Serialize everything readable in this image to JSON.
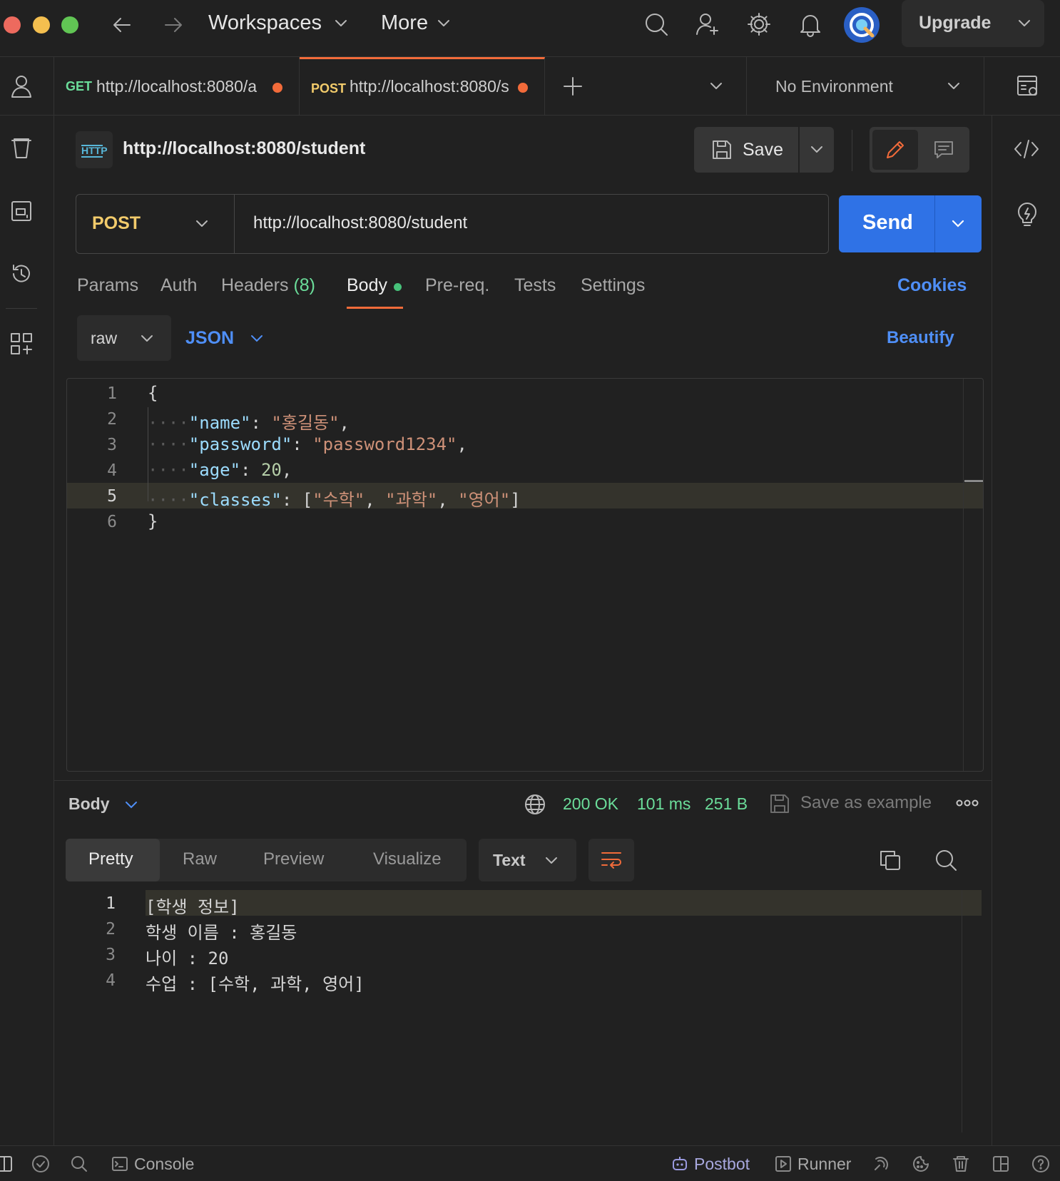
{
  "titlebar": {
    "workspaces_label": "Workspaces",
    "more_label": "More",
    "upgrade_label": "Upgrade"
  },
  "tabs": [
    {
      "method": "GET",
      "url": "http://localhost:8080/a",
      "unsaved": true
    },
    {
      "method": "POST",
      "url": "http://localhost:8080/s",
      "unsaved": true,
      "active": true
    }
  ],
  "environment": {
    "selected": "No Environment"
  },
  "request": {
    "title": "http://localhost:8080/student",
    "save_label": "Save",
    "method": "POST",
    "url": "http://localhost:8080/student",
    "send_label": "Send"
  },
  "request_tabs": {
    "params": "Params",
    "auth": "Auth",
    "headers": "Headers",
    "headers_count": "(8)",
    "body": "Body",
    "prereq": "Pre-req.",
    "tests": "Tests",
    "settings": "Settings",
    "cookies": "Cookies"
  },
  "body_options": {
    "mode": "raw",
    "language": "JSON",
    "beautify": "Beautify"
  },
  "editor": {
    "line_numbers": [
      "1",
      "2",
      "3",
      "4",
      "5",
      "6"
    ],
    "open_brace": "{",
    "close_brace": "}",
    "name_key": "\"name\"",
    "name_value": "\"홍길동\"",
    "password_key": "\"password\"",
    "password_value": "\"password1234\"",
    "age_key": "\"age\"",
    "age_value": "20",
    "classes_key": "\"classes\"",
    "classes_values": [
      "\"수학\"",
      "\"과학\"",
      "\"영어\""
    ]
  },
  "response": {
    "section_label": "Body",
    "status": "200 OK",
    "time": "101 ms",
    "size": "251 B",
    "save_example": "Save as example",
    "view_tabs": [
      "Pretty",
      "Raw",
      "Preview",
      "Visualize"
    ],
    "format": "Text",
    "line_numbers": [
      "1",
      "2",
      "3",
      "4"
    ],
    "lines": [
      "[학생 정보]",
      "학생 이름 : 홍길동",
      "나이 : 20",
      "수업 : [수학, 과학, 영어]"
    ]
  },
  "statusbar": {
    "console": "Console",
    "postbot": "Postbot",
    "runner": "Runner"
  },
  "colors": {
    "accent_orange": "#f26b3a",
    "send_blue": "#2f72e6",
    "link_blue": "#4f8ff7",
    "post_yellow": "#f2cb6b",
    "get_green": "#6bdd9a",
    "status_green": "#6bdd9a",
    "dot_green": "#47c27a"
  }
}
